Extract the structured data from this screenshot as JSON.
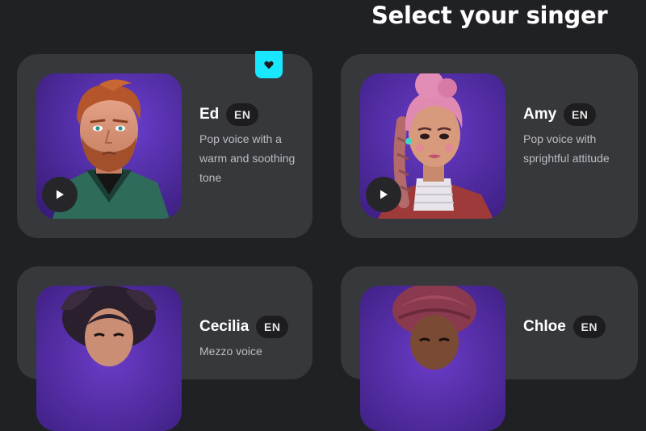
{
  "page": {
    "title": "Select your singer"
  },
  "singers": [
    {
      "name": "Ed",
      "language": "EN",
      "description": "Pop voice with a warm and soothing tone",
      "favorite": true
    },
    {
      "name": "Amy",
      "language": "EN",
      "description": "Pop voice with sprightful attitude",
      "favorite": false
    },
    {
      "name": "Cecilia",
      "language": "EN",
      "description": "Mezzo voice"
    },
    {
      "name": "Chloe",
      "language": "EN",
      "description": ""
    }
  ],
  "icons": {
    "play": "play-icon",
    "favorite": "heart-icon"
  },
  "colors": {
    "background": "#202124",
    "card": "#37383c",
    "badge_bg": "#1d1d20",
    "favorite_accent": "#19e6ff",
    "avatar_purple": "#5b2fa8"
  }
}
